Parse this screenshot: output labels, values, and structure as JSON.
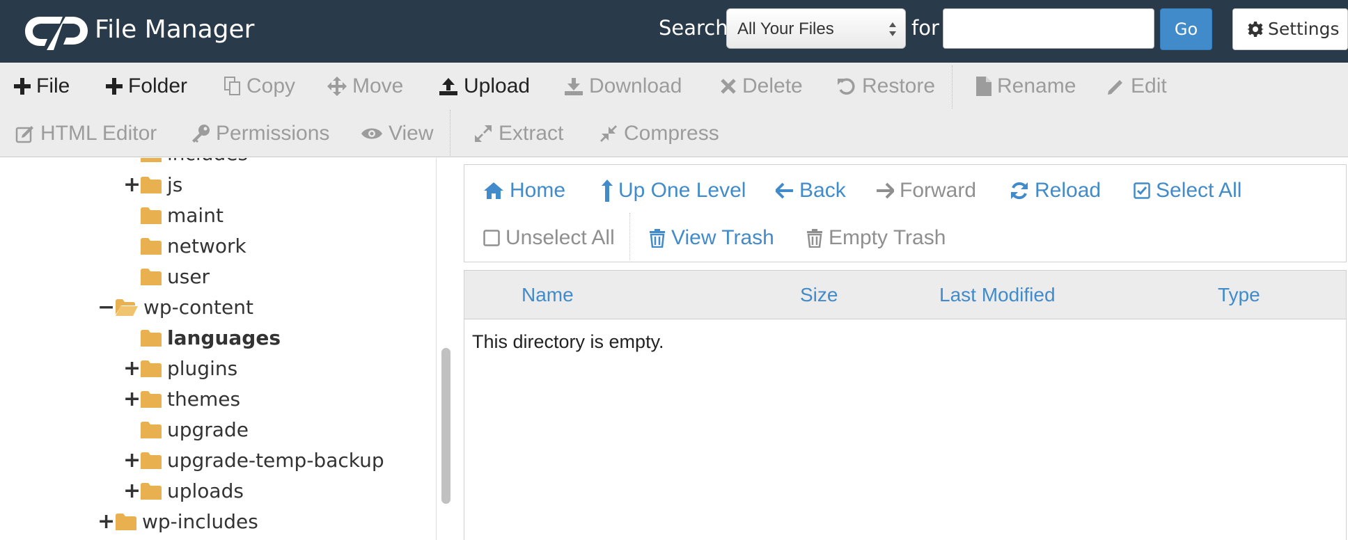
{
  "header": {
    "title": "File Manager",
    "search_label": "Search",
    "search_scope": "All Your Files",
    "for_label": "for",
    "search_query": "",
    "go_label": "Go",
    "settings_label": "Settings"
  },
  "toolbar": {
    "row1": [
      {
        "label": "File",
        "icon": "plus-icon",
        "enabled": true
      },
      {
        "label": "Folder",
        "icon": "plus-icon",
        "enabled": true
      },
      {
        "label": "Copy",
        "icon": "copy-icon",
        "enabled": false
      },
      {
        "label": "Move",
        "icon": "move-icon",
        "enabled": false
      },
      {
        "label": "Upload",
        "icon": "upload-icon",
        "enabled": true
      },
      {
        "label": "Download",
        "icon": "download-icon",
        "enabled": false
      },
      {
        "label": "Delete",
        "icon": "delete-icon",
        "enabled": false
      },
      {
        "label": "Restore",
        "icon": "restore-icon",
        "enabled": false
      },
      {
        "label": "Rename",
        "icon": "file-icon",
        "enabled": false
      },
      {
        "label": "Edit",
        "icon": "pencil-icon",
        "enabled": false
      }
    ],
    "row2": [
      {
        "label": "HTML Editor",
        "icon": "edit-square-icon",
        "enabled": false
      },
      {
        "label": "Permissions",
        "icon": "key-icon",
        "enabled": false
      },
      {
        "label": "View",
        "icon": "eye-icon",
        "enabled": false
      },
      {
        "label": "Extract",
        "icon": "expand-icon",
        "enabled": false
      },
      {
        "label": "Compress",
        "icon": "compress-icon",
        "enabled": false
      }
    ]
  },
  "tree": {
    "nodes": [
      {
        "label": "includes",
        "toggle": "",
        "open": false,
        "selected": false
      },
      {
        "label": "js",
        "toggle": "+",
        "open": false,
        "selected": false
      },
      {
        "label": "maint",
        "toggle": "",
        "open": false,
        "selected": false
      },
      {
        "label": "network",
        "toggle": "",
        "open": false,
        "selected": false
      },
      {
        "label": "user",
        "toggle": "",
        "open": false,
        "selected": false
      },
      {
        "label": "wp-content",
        "toggle": "−",
        "open": true,
        "selected": false
      },
      {
        "label": "languages",
        "toggle": "",
        "open": false,
        "selected": true
      },
      {
        "label": "plugins",
        "toggle": "+",
        "open": false,
        "selected": false
      },
      {
        "label": "themes",
        "toggle": "+",
        "open": false,
        "selected": false
      },
      {
        "label": "upgrade",
        "toggle": "",
        "open": false,
        "selected": false
      },
      {
        "label": "upgrade-temp-backup",
        "toggle": "+",
        "open": false,
        "selected": false
      },
      {
        "label": "uploads",
        "toggle": "+",
        "open": false,
        "selected": false
      },
      {
        "label": "wp-includes",
        "toggle": "+",
        "open": false,
        "selected": false
      }
    ]
  },
  "nav": {
    "home": "Home",
    "up_one_level": "Up One Level",
    "back": "Back",
    "forward": "Forward",
    "reload": "Reload",
    "select_all": "Select All",
    "unselect_all": "Unselect All",
    "view_trash": "View Trash",
    "empty_trash": "Empty Trash"
  },
  "listing": {
    "columns": [
      "Name",
      "Size",
      "Last Modified",
      "Type"
    ],
    "empty_message": "This directory is empty."
  },
  "colors": {
    "header_bg": "#293a4a",
    "accent_blue": "#428bca",
    "folder": "#e8b04f",
    "toolbar_bg": "#ececec"
  }
}
